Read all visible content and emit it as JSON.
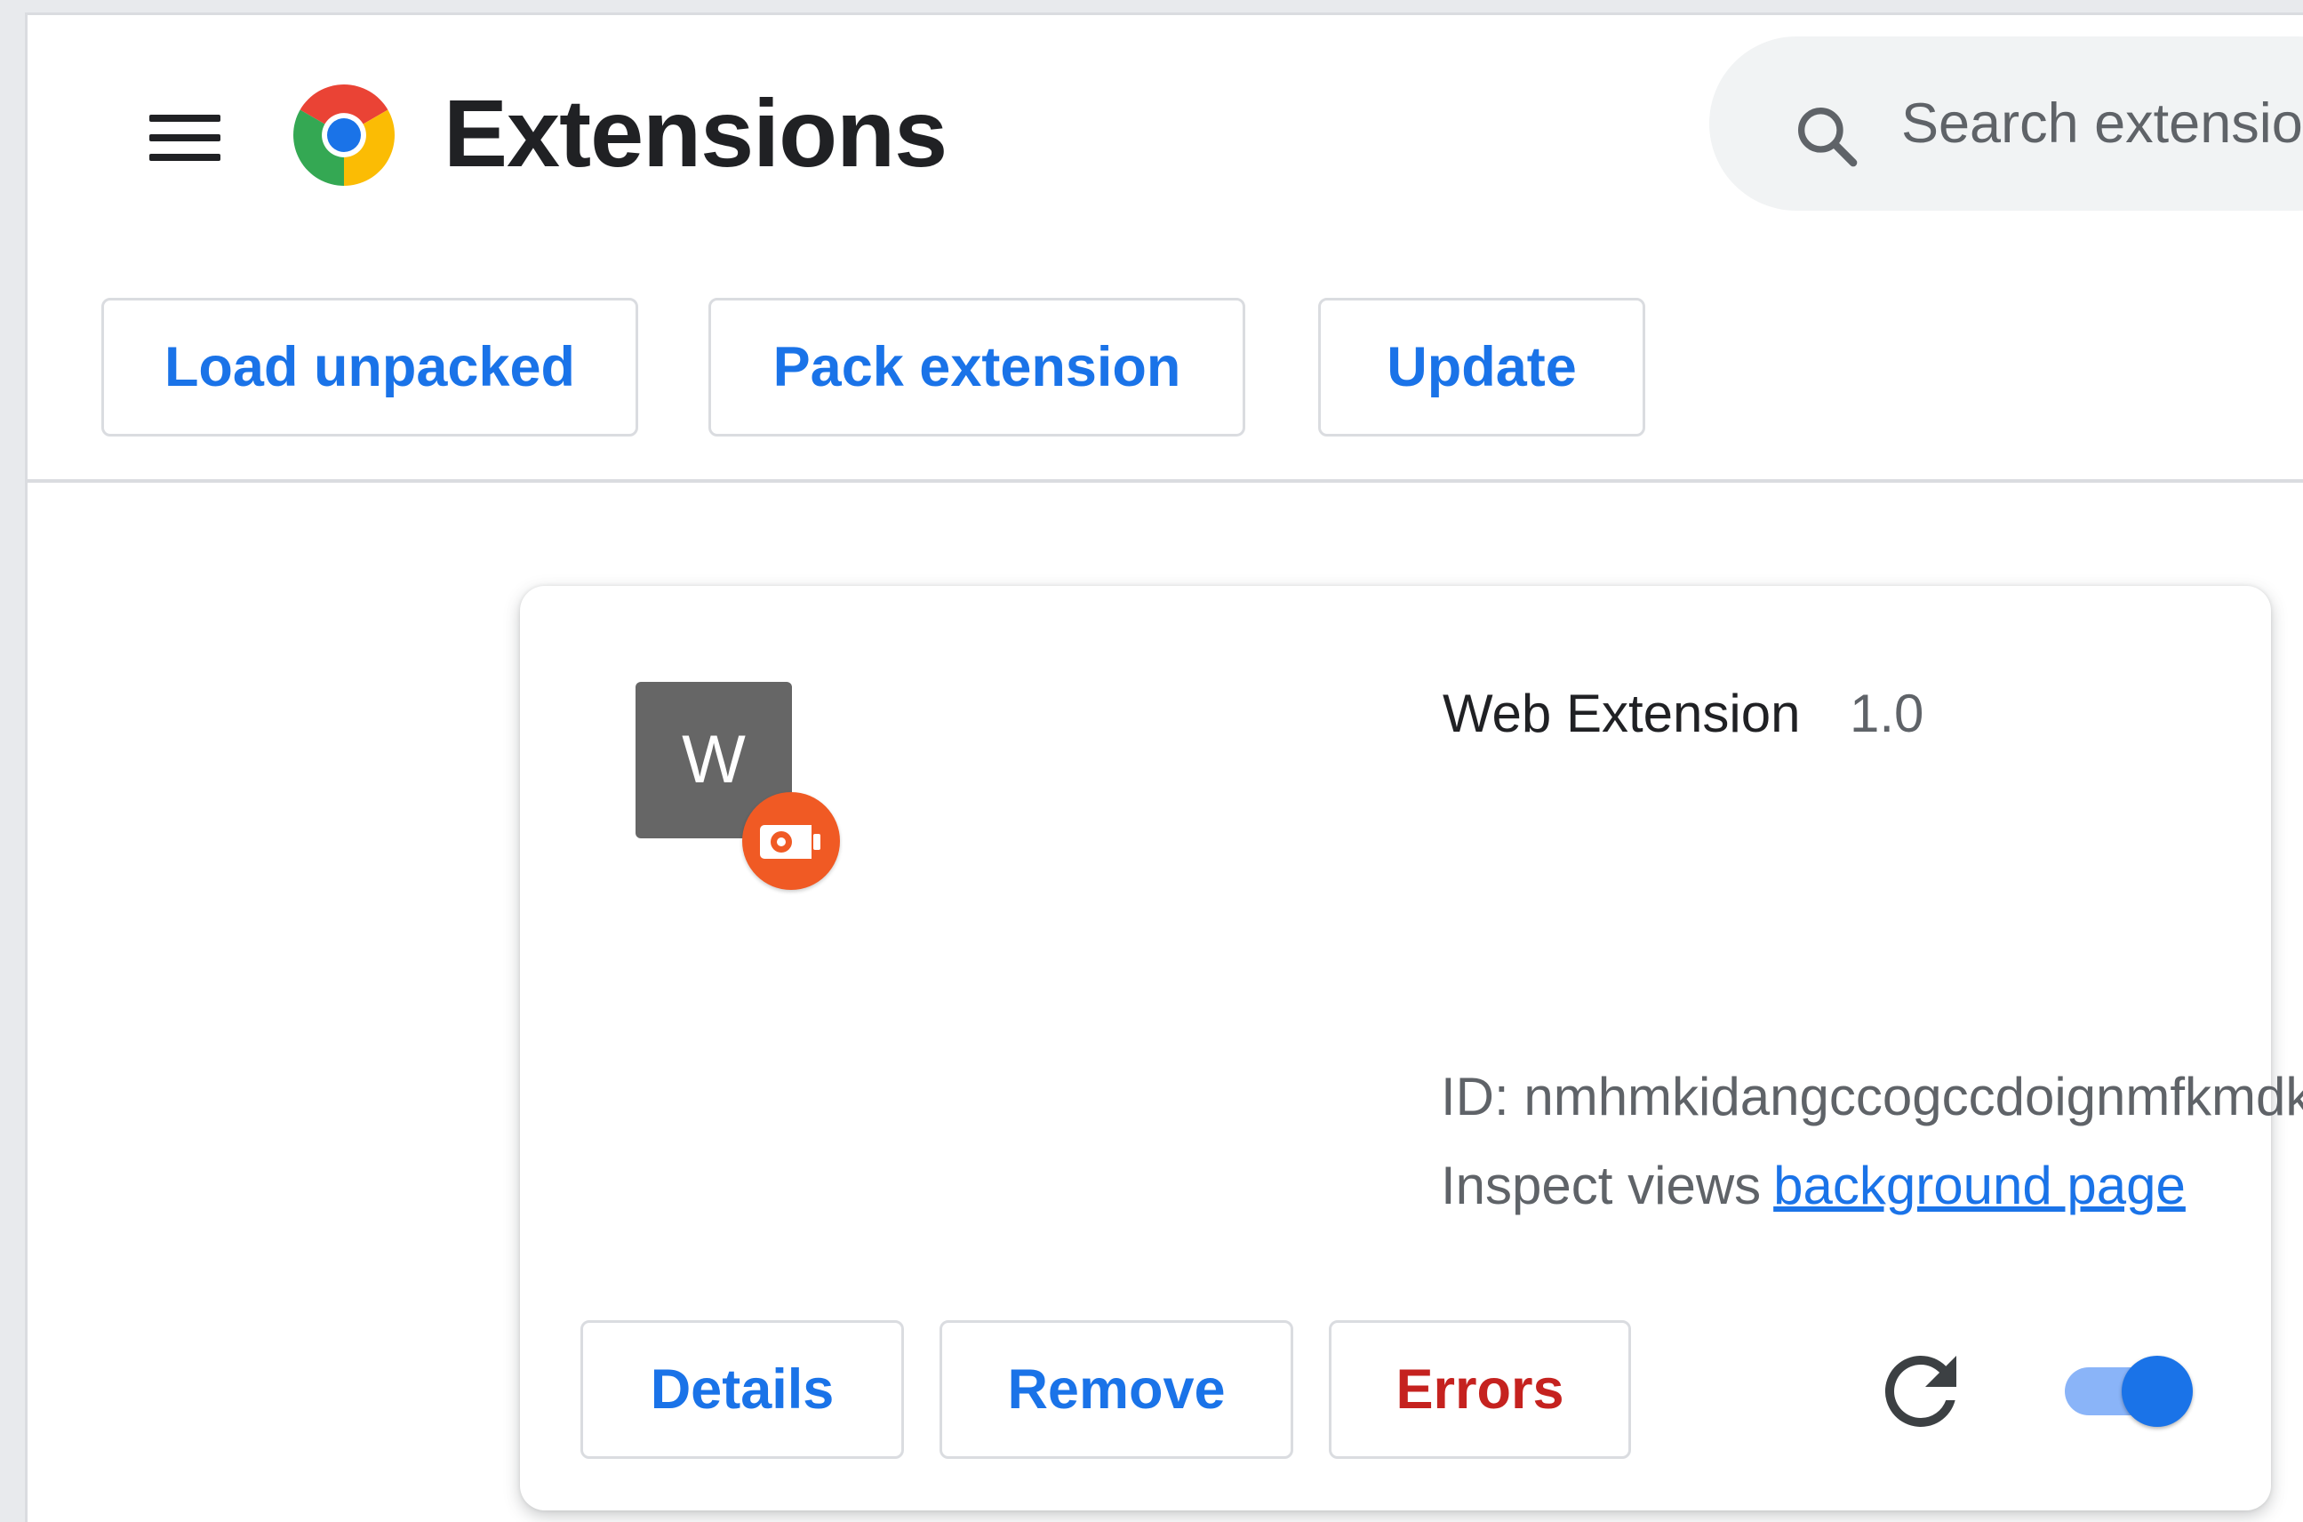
{
  "header": {
    "title": "Extensions",
    "menu_icon": "hamburger-menu-icon",
    "logo_icon": "chrome-logo-icon"
  },
  "search": {
    "icon": "search-icon",
    "placeholder": "Search extensions"
  },
  "toolbar": {
    "load_unpacked": "Load unpacked",
    "pack_extension": "Pack extension",
    "update": "Update"
  },
  "extension": {
    "icon_letter": "W",
    "badge_icon": "unpacked-extension-badge-icon",
    "name": "Web Extension",
    "version": "1.0",
    "id_text": "ID: nmhmkidangccogccdoignmfkmdkebjhf",
    "inspect_label": "Inspect views",
    "inspect_link": "background page",
    "details_label": "Details",
    "remove_label": "Remove",
    "errors_label": "Errors",
    "reload_icon": "reload-icon",
    "enabled": true
  },
  "colors": {
    "accent": "#1a73e8",
    "error": "#c5221f",
    "badge": "#f05a24",
    "toggle_track": "#8ab4f8",
    "icon_bg": "#666666"
  }
}
